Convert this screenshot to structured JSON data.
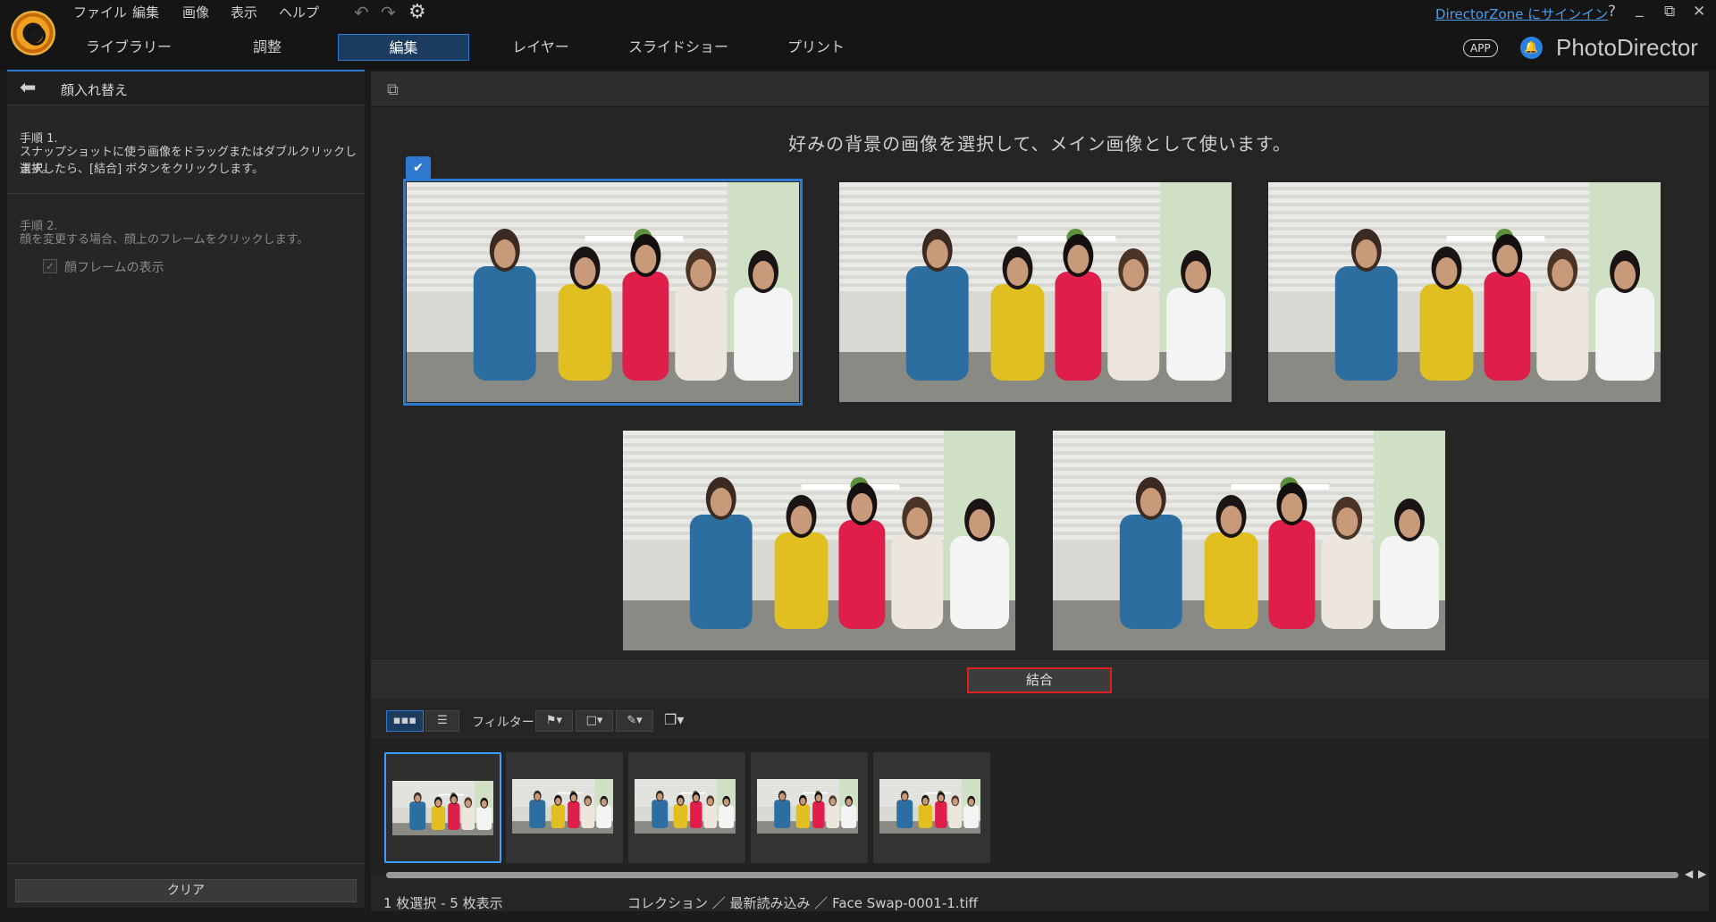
{
  "menu": {
    "file": "ファイル",
    "edit": "編集",
    "image": "画像",
    "view": "表示",
    "help": "ヘルプ"
  },
  "tabs": [
    "ライブラリー",
    "調整",
    "編集",
    "レイヤー",
    "スライドショー",
    "プリント"
  ],
  "header": {
    "signin_link": "DirectorZone にサインイン",
    "help_glyph": "?",
    "minimize_glyph": "_",
    "restore_glyph": "⧉",
    "app_badge": "APP",
    "brand": "PhotoDirector"
  },
  "left_panel": {
    "title": "顔入れ替え",
    "step1_title": "手順 1.",
    "step1_line1": "スナップショットに使う画像をドラッグまたはダブルクリックします。",
    "step1_line2": "選択したら、[結合] ボタンをクリックします。",
    "step2_title": "手順 2.",
    "step2_line1": "顔を変更する場合、顔上のフレームをクリックします。",
    "show_face_frames": "顔フレームの表示",
    "clear_button": "クリア"
  },
  "main": {
    "instruction": "好みの背景の画像を選択して、メイン画像として使います。",
    "merge_button": "結合",
    "filter_label": "フィルター:",
    "photo_count": 5,
    "selected_index": 0
  },
  "status": {
    "count": "1 枚選択 - 5 枚表示",
    "path": "コレクション ／ 最新読み込み ／ Face Swap-0001-1.tiff"
  },
  "colors": {
    "accent": "#2f7ad0",
    "merge_highlight": "#e02020",
    "link": "#4a9eee"
  },
  "icons": {
    "back": "arrow-left-icon",
    "compare": "compare-view-icon",
    "anchor": "main-image-icon",
    "grid": "grid-view-icon",
    "list": "list-view-icon",
    "flag": "flag-filter-icon",
    "frame": "frame-filter-icon",
    "pen": "pen-filter-icon",
    "stack": "stack-icon"
  }
}
